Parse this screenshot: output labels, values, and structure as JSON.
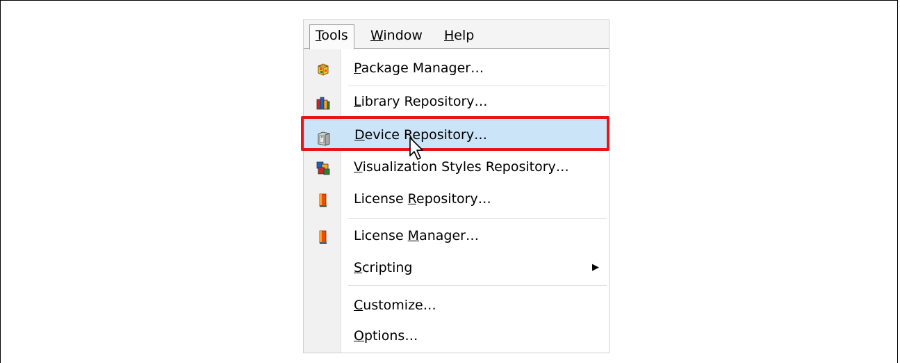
{
  "menubar": {
    "items": [
      {
        "label": "Tools",
        "underline": "T",
        "rest": "ools"
      },
      {
        "label": "Window",
        "underline": "W",
        "rest": "indow"
      },
      {
        "label": "Help",
        "underline": "H",
        "rest": "elp"
      }
    ]
  },
  "menu": {
    "items": [
      {
        "pre": "",
        "u": "P",
        "post": "ackage Manager…",
        "icon": "package-icon"
      },
      {
        "pre": "",
        "u": "L",
        "post": "ibrary Repository…",
        "icon": "library-icon"
      },
      {
        "pre": "",
        "u": "D",
        "post": "evice Repository…",
        "icon": "device-icon",
        "highlighted": true
      },
      {
        "pre": "",
        "u": "V",
        "post": "isualization Styles Repository…",
        "icon": "visualization-icon"
      },
      {
        "pre": "License ",
        "u": "R",
        "post": "epository…",
        "icon": "license-icon"
      },
      {
        "pre": "License ",
        "u": "M",
        "post": "anager…",
        "icon": "license-manager-icon"
      },
      {
        "pre": "",
        "u": "S",
        "post": "cripting",
        "icon": "",
        "submenu_arrow": "▶"
      },
      {
        "pre": "",
        "u": "C",
        "post": "ustomize…",
        "icon": ""
      },
      {
        "pre": "",
        "u": "O",
        "post": "ptions…",
        "icon": ""
      }
    ]
  },
  "colors": {
    "highlight": "#cce4f7",
    "annotation": "#e8141c"
  }
}
